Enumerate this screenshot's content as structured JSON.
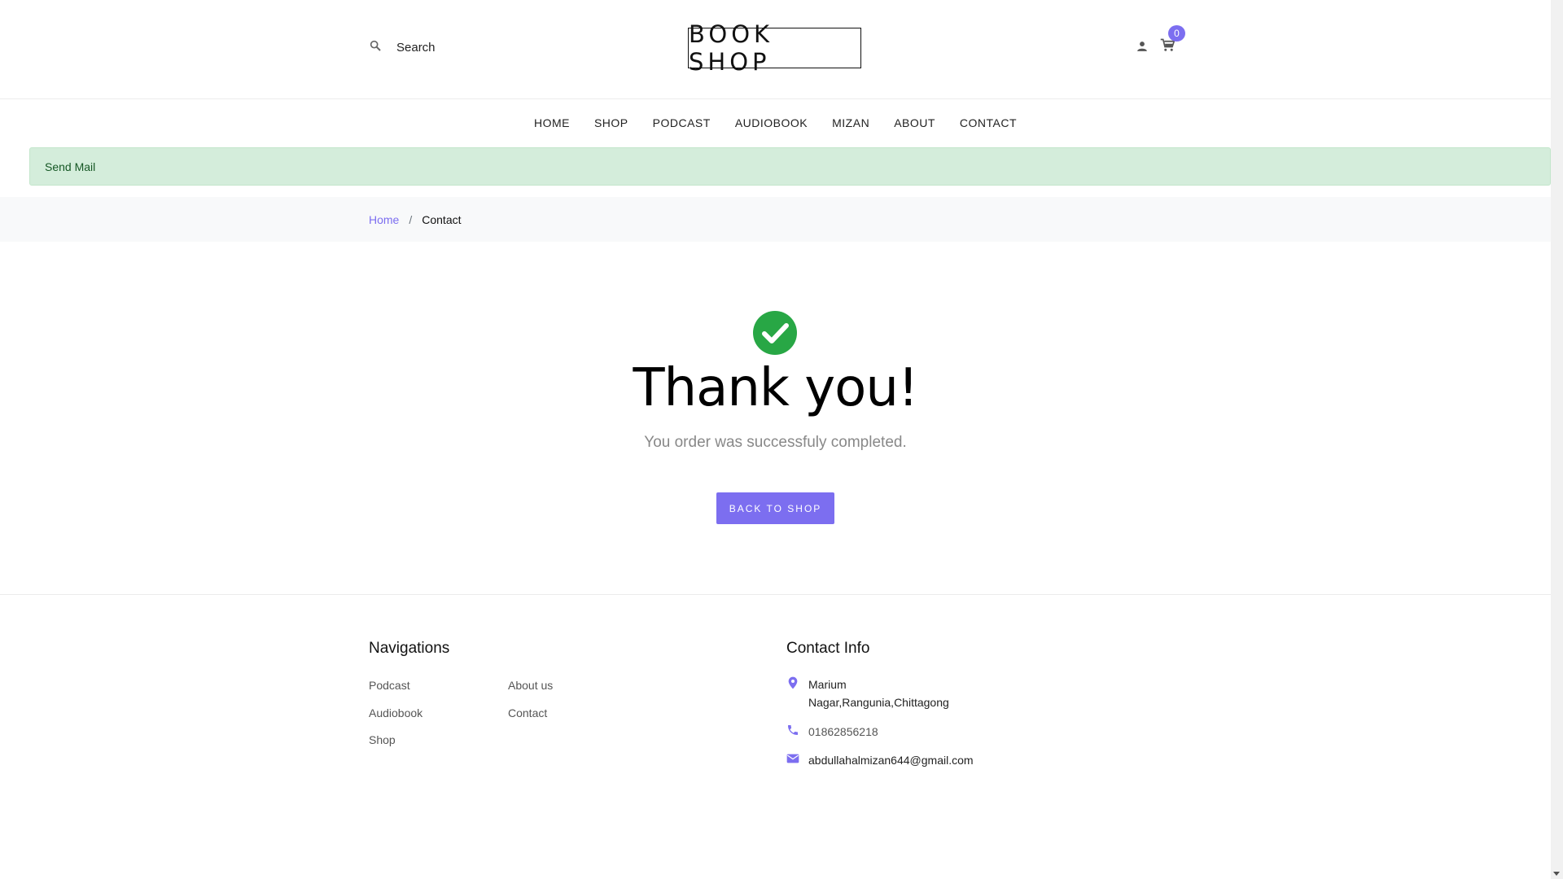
{
  "header": {
    "search_placeholder": "Search",
    "logo_text": "BOOK SHOP",
    "cart_count": "0"
  },
  "nav": {
    "items": [
      "HOME",
      "SHOP",
      "PODCAST",
      "AUDIOBOOK",
      "MIZAN",
      "ABOUT",
      "CONTACT"
    ]
  },
  "alert": {
    "message": "Send Mail"
  },
  "breadcrumb": {
    "home": "Home",
    "separator": "/",
    "current": "Contact"
  },
  "thanks": {
    "title": "Thank you!",
    "subtitle": "You order was successfuly completed.",
    "button_label": "BACK TO SHOP"
  },
  "footer": {
    "navigations": {
      "heading": "Navigations",
      "links": [
        "Podcast",
        "Audiobook",
        "Shop",
        "About us",
        "Contact"
      ]
    },
    "contact": {
      "heading": "Contact Info",
      "address_line1": "Marium",
      "address_line2": "Nagar,Rangunia,Chittagong",
      "phone": "01862856218",
      "email": "abdullahalmizan644@gmail.com"
    }
  },
  "colors": {
    "accent": "#7c6ef0",
    "success": "#28a745",
    "alert_bg": "#d4eddb"
  }
}
